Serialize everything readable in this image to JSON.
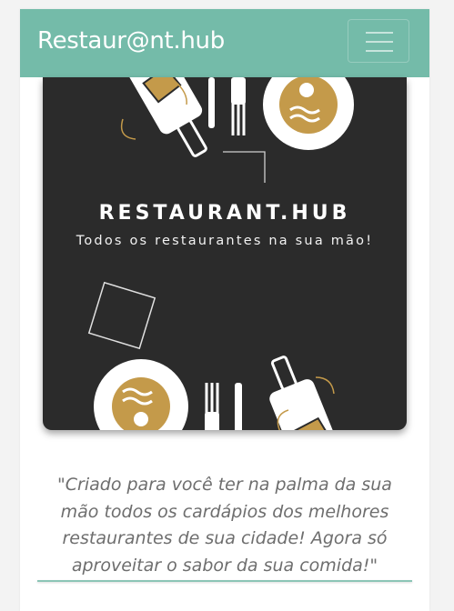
{
  "navbar": {
    "brand": "Restaur@nt.hub",
    "menu_icon": "hamburger-icon"
  },
  "banner": {
    "title": "RESTAURANT.HUB",
    "subtitle": "Todos os restaurantes na sua mão!",
    "background_color": "#2b2b2b",
    "accent_color": "#c49a4a"
  },
  "quote": {
    "text": "\"Criado para você ter na palma da sua mão todos os cardápios dos melhores restaurantes de sua cidade! Agora só aproveitar o sabor da sua comida!\""
  },
  "colors": {
    "brand": "#74bba9",
    "divider": "#8cc5b6",
    "quote_text": "#6e6e6e"
  }
}
